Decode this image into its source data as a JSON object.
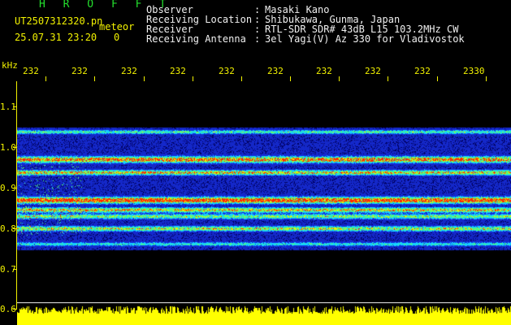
{
  "header": {
    "app_title": "H R O F F T",
    "file_name": "UT2507312320.pn",
    "mode": "meteor",
    "datetime": "25.07.31 23:20",
    "counter": "0",
    "fields": [
      {
        "label": "Observer",
        "value": "Masaki Kano"
      },
      {
        "label": "Receiving Location",
        "value": "Shibukawa, Gunma, Japan"
      },
      {
        "label": "Receiver",
        "value": "RTL-SDR SDR# 43dB L15 103.2MHz CW"
      },
      {
        "label": "Receiving Antenna",
        "value": "3el Yagi(V) Az 330 for Vladivostok"
      }
    ]
  },
  "spectrogram": {
    "y_unit": "kHz",
    "y_ticks": [
      "1.1",
      "1.0",
      "0.9",
      "0.8",
      "0.7",
      "0.6"
    ],
    "x_ticks": [
      "232",
      "232",
      "232",
      "232",
      "232",
      "232",
      "232",
      "232",
      "232",
      "2330"
    ],
    "colors": {
      "background": "#000066",
      "bands": [
        "#2244ff",
        "#19d9ff",
        "#44ff44",
        "#ffff00",
        "#ff2200"
      ],
      "axes": "#f2f200",
      "level": "#ffff00"
    }
  }
}
